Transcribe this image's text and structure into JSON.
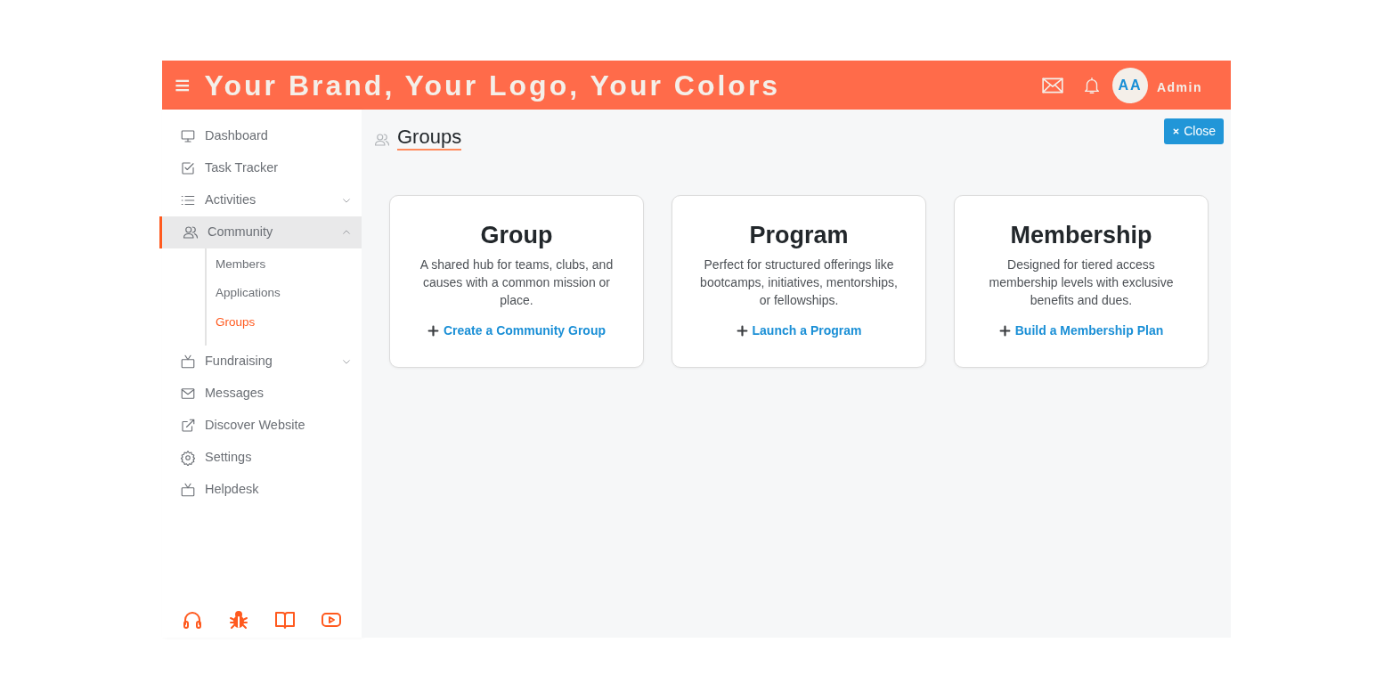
{
  "header": {
    "menu_icon": "≡",
    "brand": "Your Brand, Your Logo, Your Colors",
    "avatar": "AA",
    "user": "Admin"
  },
  "sidebar": {
    "items": [
      {
        "label": "Dashboard",
        "selected": false
      },
      {
        "label": "Task Tracker",
        "selected": false
      },
      {
        "label": "Activities",
        "selected": false,
        "expanded": false
      },
      {
        "label": "Community",
        "selected": true,
        "expanded": true,
        "children": [
          {
            "label": "Members",
            "selected": false
          },
          {
            "label": "Applications",
            "selected": false
          },
          {
            "label": "Groups",
            "selected": true
          }
        ]
      },
      {
        "label": "Fundraising",
        "selected": false,
        "expanded": false
      },
      {
        "label": "Messages",
        "selected": false
      },
      {
        "label": "Discover Website",
        "selected": false
      },
      {
        "label": "Settings",
        "selected": false
      },
      {
        "label": "Helpdesk",
        "selected": false
      }
    ]
  },
  "page": {
    "title": "Groups",
    "close_button": "Close"
  },
  "cards": [
    {
      "title": "Group",
      "description": "A shared hub for teams, clubs, and causes with a common mission or place.",
      "action": "Create a Community Group"
    },
    {
      "title": "Program",
      "description": "Perfect for structured offerings like bootcamps, initiatives, mentorships, or fellowships.",
      "action": "Launch a Program"
    },
    {
      "title": "Membership",
      "description": "Designed for tiered access membership levels with exclusive benefits and dues.",
      "action": "Build a Membership Plan"
    }
  ]
}
